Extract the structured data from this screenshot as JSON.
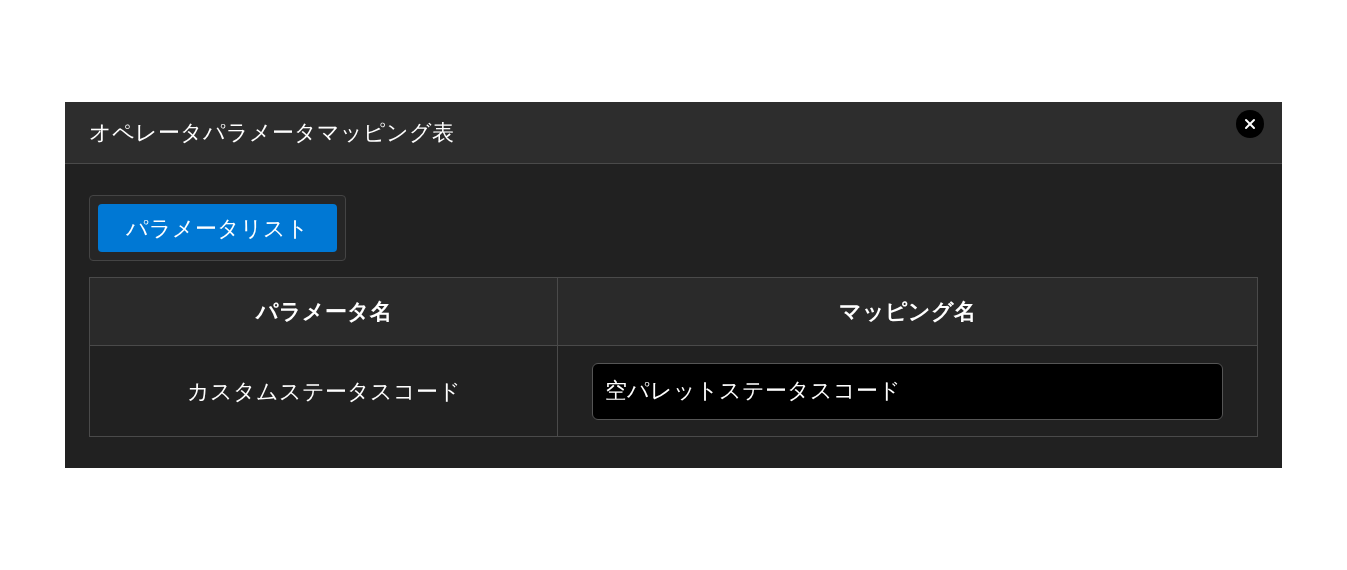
{
  "dialog": {
    "title": "オペレータパラメータマッピング表"
  },
  "tabs": [
    {
      "label": "パラメータリスト",
      "selected": true
    }
  ],
  "table": {
    "columns": [
      "パラメータ名",
      "マッピング名"
    ],
    "rows": [
      {
        "parameter": "カスタムステータスコード",
        "mapping": "空パレットステータスコード"
      }
    ]
  }
}
